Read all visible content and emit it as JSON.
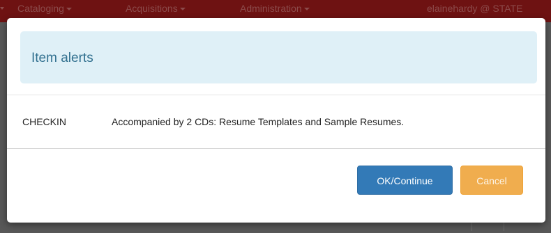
{
  "navbar": {
    "items": [
      {
        "label": "Cataloging"
      },
      {
        "label": "Acquisitions"
      },
      {
        "label": "Administration"
      }
    ],
    "user": "elainehardy @ STATE"
  },
  "modal": {
    "title": "Item alerts",
    "alerts": [
      {
        "type": "CHECKIN",
        "message": "Accompanied by 2 CDs: Resume Templates and Sample Resumes."
      }
    ],
    "buttons": {
      "ok_label": "OK/Continue",
      "cancel_label": "Cancel"
    }
  },
  "colors": {
    "navbar": "#6e1212",
    "alert_bg": "#dff0f7",
    "alert_text": "#31708f",
    "primary": "#337ab7",
    "warning": "#f0ad4e"
  }
}
